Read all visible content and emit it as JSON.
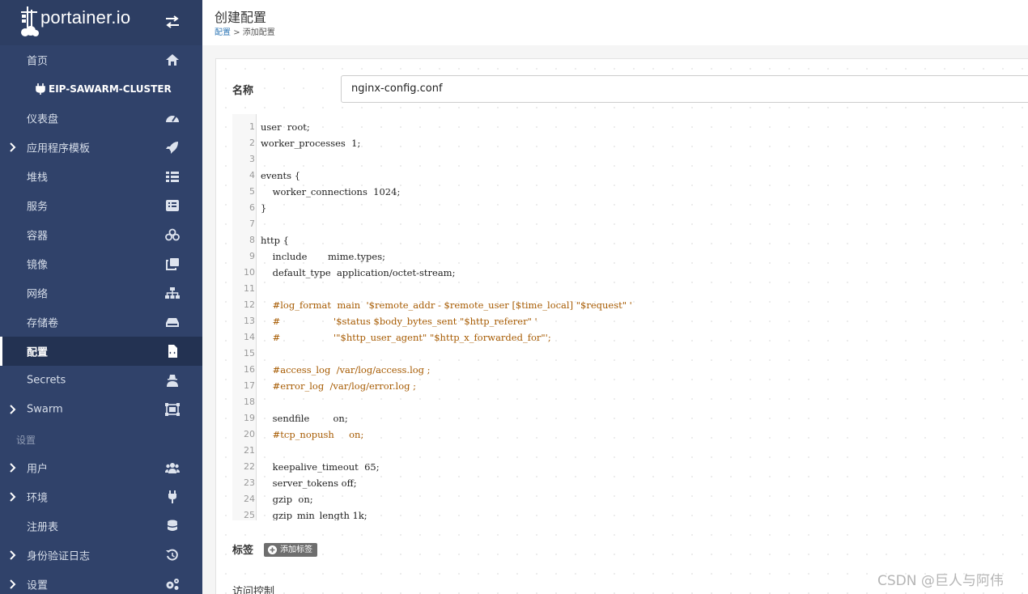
{
  "brand": {
    "name": "portainer.io"
  },
  "sidebar": {
    "cluster": "EIP-SAWARM-CLUSTER",
    "items": [
      {
        "label": "首页",
        "icon": "home-icon"
      },
      {
        "label": "仪表盘",
        "icon": "tachometer-icon"
      },
      {
        "label": "应用程序模板",
        "icon": "rocket-icon",
        "expandable": true
      },
      {
        "label": "堆栈",
        "icon": "th-list-icon"
      },
      {
        "label": "服务",
        "icon": "list-alt-icon"
      },
      {
        "label": "容器",
        "icon": "cubes-icon"
      },
      {
        "label": "镜像",
        "icon": "clone-icon"
      },
      {
        "label": "网络",
        "icon": "sitemap-icon"
      },
      {
        "label": "存储卷",
        "icon": "hdd-icon"
      },
      {
        "label": "配置",
        "icon": "file-code-icon",
        "active": true
      },
      {
        "label": "Secrets",
        "icon": "user-secret-icon"
      },
      {
        "label": "Swarm",
        "icon": "object-group-icon",
        "expandable": true
      }
    ],
    "settings_title": "设置",
    "settings_items": [
      {
        "label": "用户",
        "icon": "users-icon",
        "expandable": true
      },
      {
        "label": "环境",
        "icon": "plug-icon",
        "expandable": true
      },
      {
        "label": "注册表",
        "icon": "database-icon"
      },
      {
        "label": "身份验证日志",
        "icon": "history-icon",
        "expandable": true
      },
      {
        "label": "设置",
        "icon": "cogs-icon",
        "expandable": true
      }
    ]
  },
  "header": {
    "title": "创建配置",
    "breadcrumb_link": "配置",
    "breadcrumb_sep": ">",
    "breadcrumb_current": "添加配置"
  },
  "form": {
    "name_label": "名称",
    "name_value": "nginx-config.conf",
    "tags_label": "标签",
    "add_tag_label": "添加标签",
    "access_control_label": "访问控制"
  },
  "editor": {
    "lines": [
      {
        "n": "1",
        "text": "user  root;"
      },
      {
        "n": "2",
        "text": "worker_processes  1;"
      },
      {
        "n": "3",
        "text": ""
      },
      {
        "n": "4",
        "text": "events {"
      },
      {
        "n": "5",
        "text": "    worker_connections  1024;"
      },
      {
        "n": "6",
        "text": "}"
      },
      {
        "n": "7",
        "text": ""
      },
      {
        "n": "8",
        "text": "http {"
      },
      {
        "n": "9",
        "text": "    include       mime.types;"
      },
      {
        "n": "10",
        "text": "    default_type  application/octet-stream;"
      },
      {
        "n": "11",
        "text": ""
      },
      {
        "n": "12",
        "text": "    #log_format  main  '$remote_addr - $remote_user [$time_local] \"$request\" '",
        "comment": true
      },
      {
        "n": "13",
        "text": "    #                  '$status $body_bytes_sent \"$http_referer\" '",
        "comment": true
      },
      {
        "n": "14",
        "text": "    #                  '\"$http_user_agent\" \"$http_x_forwarded_for\"';",
        "comment": true
      },
      {
        "n": "15",
        "text": ""
      },
      {
        "n": "16",
        "text": "    #access_log  /var/log/access.log ;",
        "comment": true
      },
      {
        "n": "17",
        "text": "    #error_log  /var/log/error.log ;",
        "comment": true
      },
      {
        "n": "18",
        "text": ""
      },
      {
        "n": "19",
        "text": "    sendfile        on;"
      },
      {
        "n": "20",
        "text": "    #tcp_nopush     on;",
        "comment": true
      },
      {
        "n": "21",
        "text": ""
      },
      {
        "n": "22",
        "text": "    keepalive_timeout  65;"
      },
      {
        "n": "23",
        "text": "    server_tokens off;"
      },
      {
        "n": "24",
        "text": "    gzip  on;"
      },
      {
        "n": "25",
        "text": "    gzip_min_length 1k;"
      }
    ]
  },
  "watermark": "CSDN @巨人与阿伟",
  "colors": {
    "sidebar_bg": "#30426a",
    "sidebar_active": "#233252",
    "comment": "#a65a00",
    "link": "#337ab7"
  }
}
